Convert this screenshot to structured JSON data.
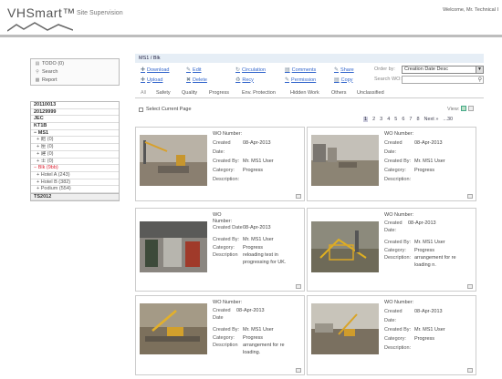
{
  "header": {
    "logo": "VHSmart™",
    "logo_sub": "Site Supervision",
    "welcome": "Welcome, Mr. Technical I"
  },
  "quick_links": [
    {
      "label": "TODO (0)",
      "icon": "clipboard-icon"
    },
    {
      "label": "Search",
      "icon": "search-icon"
    },
    {
      "label": "Report",
      "icon": "chart-icon"
    }
  ],
  "tree": [
    {
      "label": "20110013",
      "style": "bold"
    },
    {
      "label": "20129999",
      "style": "bold"
    },
    {
      "label": "JEC",
      "style": "bold"
    },
    {
      "label": "KT1B",
      "style": "bold"
    },
    {
      "label": "− MS1",
      "style": "bold"
    },
    {
      "label": "+ 館 (0)",
      "style": "sub"
    },
    {
      "label": "+ 座 (0)",
      "style": "sub"
    },
    {
      "label": "+ 建 (0)",
      "style": "sub"
    },
    {
      "label": "+ 士 (0)",
      "style": "sub"
    },
    {
      "label": "− Blk (9bb)",
      "style": "active"
    },
    {
      "label": "+ Hotel A (243)",
      "style": "sub"
    },
    {
      "label": "+ Hotel B (382)",
      "style": "sub"
    },
    {
      "label": "+ Podium (554)",
      "style": "sub"
    },
    {
      "label": "TS2012",
      "style": "group"
    }
  ],
  "breadcrumb": "MS1 / Blk",
  "toolbar": {
    "buttons": [
      {
        "label": "Download",
        "icon": "download-icon"
      },
      {
        "label": "Upload",
        "icon": "upload-icon"
      },
      {
        "label": "Edit",
        "icon": "pencil-icon"
      },
      {
        "label": "Delete",
        "icon": "delete-icon"
      },
      {
        "label": "Circulation",
        "icon": "circulation-icon"
      },
      {
        "label": "Recy",
        "icon": "recycle-icon"
      },
      {
        "label": "Comments",
        "icon": "comments-icon"
      },
      {
        "label": "Permission",
        "icon": "permission-icon"
      },
      {
        "label": "Share",
        "icon": "share-icon"
      },
      {
        "label": "Copy",
        "icon": "copy-icon"
      }
    ],
    "order_by_label": "Order by:",
    "order_by_value": "Creation Date Desc",
    "search_label": "Search WO:",
    "search_value": ""
  },
  "filters": [
    "All",
    "Safety",
    "Quality",
    "Progress",
    "Env. Protection",
    "Hidden Work",
    "Others",
    "Unclassified"
  ],
  "select_current_page": "Select Current Page",
  "view_label": "View:",
  "pager": [
    "1",
    "2",
    "3",
    "4",
    "5",
    "6",
    "7",
    "8",
    "Next »",
    "...30"
  ],
  "cards": [
    {
      "wo_label": "WO Number:",
      "rows": [
        {
          "k": "Created Date:",
          "v": "08-Apr-2013"
        },
        {
          "k": "Created By:",
          "v": "Mr. MS1 User"
        },
        {
          "k": "Category:",
          "v": "Progress"
        },
        {
          "k": "Description:",
          "v": ""
        }
      ]
    },
    {
      "wo_label": "WO Number:",
      "rows": [
        {
          "k": "Created Date:",
          "v": "08-Apr-2013"
        },
        {
          "k": "Created By:",
          "v": "Mr. MS1 User"
        },
        {
          "k": "Category:",
          "v": "Progress"
        },
        {
          "k": "Description:",
          "v": ""
        }
      ]
    },
    {
      "wo_label": "WO Number:",
      "rows": [
        {
          "k": "Created Date",
          "v": "08-Apr-2013"
        },
        {
          "k": "Created By:",
          "v": "Mr. MS1 User"
        },
        {
          "k": "Category:",
          "v": "Progress"
        },
        {
          "k": "Description",
          "v": "reloading test in progressing for UK."
        }
      ]
    },
    {
      "wo_label": "WO Number:",
      "rows": [
        {
          "k": "Created Date:",
          "v": "08-Apr-2013"
        },
        {
          "k": "Created By:",
          "v": "Mr. MS1 User"
        },
        {
          "k": "Category:",
          "v": "Progress"
        },
        {
          "k": "Description:",
          "v": "arrangement for re loading n."
        }
      ]
    },
    {
      "wo_label": "WO Number:",
      "rows": [
        {
          "k": "Created Date",
          "v": "08-Apr-2013"
        },
        {
          "k": "Created By:",
          "v": "Mr. MS1 User"
        },
        {
          "k": "Category:",
          "v": "Progress"
        },
        {
          "k": "Description",
          "v": "arrangement for re loading."
        }
      ]
    },
    {
      "wo_label": "WO Number:",
      "rows": [
        {
          "k": "Created Date:",
          "v": "08-Apr-2013"
        },
        {
          "k": "Created By:",
          "v": "Mr. MS1 User"
        },
        {
          "k": "Category:",
          "v": "Progress"
        },
        {
          "k": "Description:",
          "v": ""
        }
      ]
    }
  ]
}
